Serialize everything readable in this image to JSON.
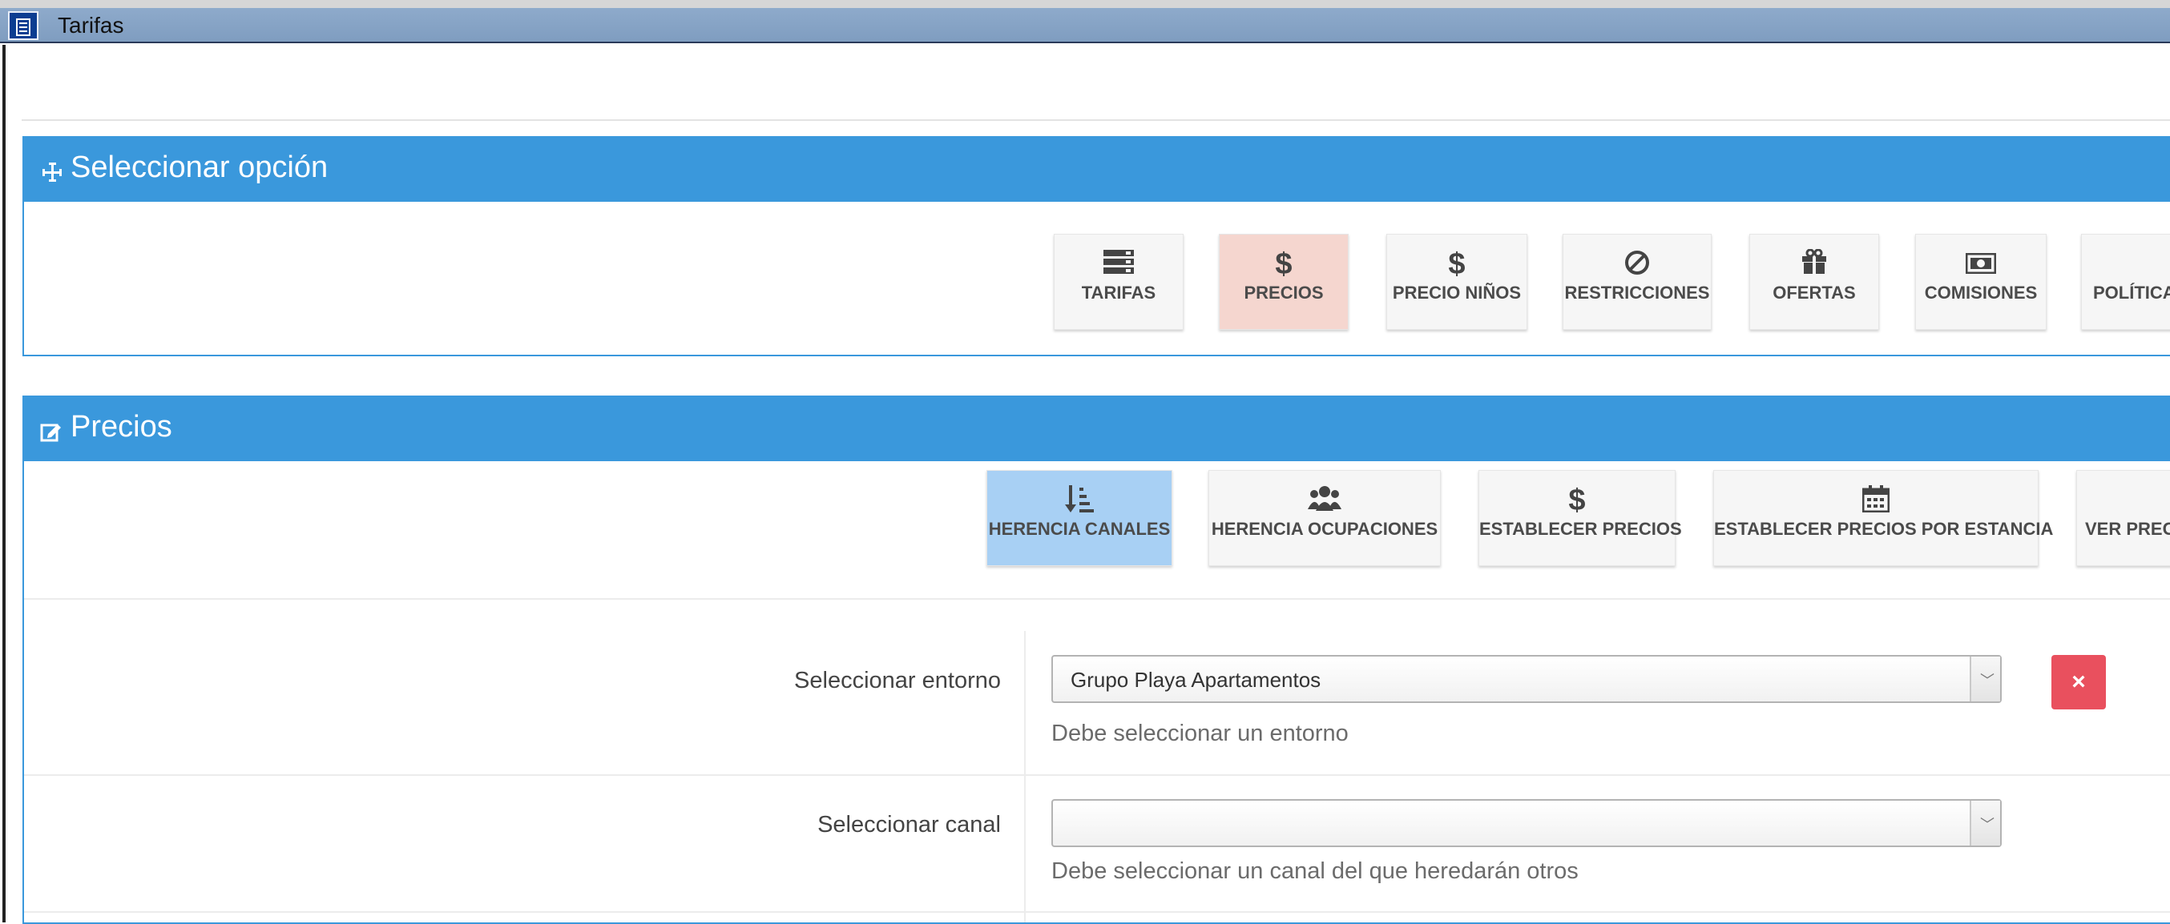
{
  "window": {
    "title": "Tarifas",
    "icon": "calculator-icon"
  },
  "select_option_panel": {
    "title": "Seleccionar opción",
    "icon": "move-arrows-icon",
    "tiles": [
      {
        "label": "TARIFAS",
        "icon": "server-list-icon",
        "active": false
      },
      {
        "label": "PRECIOS",
        "icon": "dollar-icon",
        "active": true
      },
      {
        "label": "PRECIO NIÑOS",
        "icon": "dollar-icon",
        "active": false
      },
      {
        "label": "RESTRICCIONES",
        "icon": "ban-icon",
        "active": false
      },
      {
        "label": "OFERTAS",
        "icon": "gift-icon",
        "active": false
      },
      {
        "label": "COMISIONES",
        "icon": "money-bill-icon",
        "active": false
      },
      {
        "label": "POLÍTICAS",
        "icon": "policy-icon",
        "active": false
      }
    ]
  },
  "prices_panel": {
    "title": "Precios",
    "icon": "edit-icon",
    "tabs": [
      {
        "label": "HERENCIA CANALES",
        "icon": "sort-amount-icon",
        "active": true
      },
      {
        "label": "HERENCIA OCUPACIONES",
        "icon": "users-icon",
        "active": false
      },
      {
        "label": "ESTABLECER PRECIOS",
        "icon": "dollar-icon",
        "active": false
      },
      {
        "label": "ESTABLECER PRECIOS POR ESTANCIA",
        "icon": "calendar-icon",
        "active": false
      },
      {
        "label": "VER PRECIOS",
        "icon": "eye-icon",
        "active": false
      }
    ],
    "fields": {
      "environment": {
        "label": "Seleccionar entorno",
        "value": "Grupo Playa Apartamentos",
        "help": "Debe seleccionar un entorno"
      },
      "channel": {
        "label": "Seleccionar canal",
        "value": "",
        "help": "Debe seleccionar un canal del que heredarán otros"
      }
    },
    "clear_button_symbol": "×"
  },
  "colors": {
    "header_blue": "#3a98dc",
    "active_pink": "#f5d6cf",
    "active_blue": "#a8d0f4",
    "danger_red": "#e9505e",
    "titlebar": "#8eaacb"
  }
}
